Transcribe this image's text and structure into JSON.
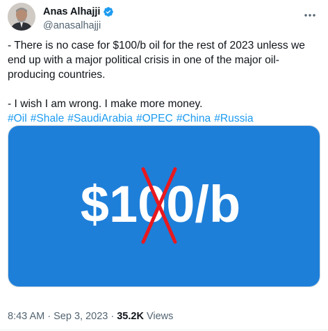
{
  "author": {
    "display_name": "Anas Alhajji",
    "handle": "@anasalhajji",
    "verified": true
  },
  "tweet": {
    "paragraph_1": "- There is no case for $100/b oil for the rest of 2023 unless we end up with a major political crisis in one of the major oil-producing countries.",
    "paragraph_2": "- I wish I am wrong. I make more money.",
    "hashtags": [
      "#Oil",
      "#Shale",
      "#SaudiArabia",
      "#OPEC",
      "#China",
      "#Russia"
    ]
  },
  "media": {
    "image_text": "$100/b",
    "background_color": "#1e7fd9",
    "strike_color": "#e8181f"
  },
  "meta": {
    "time": "8:43 AM",
    "separator": "·",
    "date": "Sep 3, 2023",
    "views_count": "35.2K",
    "views_label": "Views"
  },
  "colors": {
    "link": "#1d9bf0",
    "verified": "#1d9bf0",
    "secondary_text": "#536471"
  }
}
